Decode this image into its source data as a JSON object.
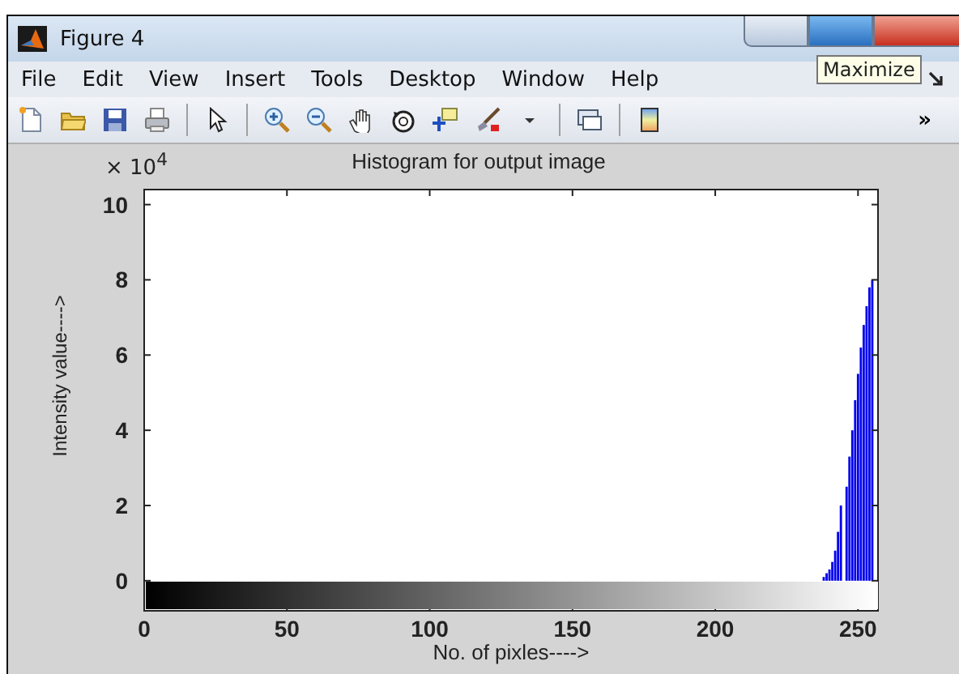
{
  "window": {
    "title": "Figure 4",
    "tooltip": "Maximize"
  },
  "menu": [
    "File",
    "Edit",
    "View",
    "Insert",
    "Tools",
    "Desktop",
    "Window",
    "Help"
  ],
  "toolbar": [
    {
      "kind": "new"
    },
    {
      "kind": "open"
    },
    {
      "kind": "save"
    },
    {
      "kind": "print"
    },
    {
      "kind": "separator"
    },
    {
      "kind": "pointer"
    },
    {
      "kind": "separator"
    },
    {
      "kind": "zoom-in"
    },
    {
      "kind": "zoom-out"
    },
    {
      "kind": "pan"
    },
    {
      "kind": "rotate"
    },
    {
      "kind": "cursor"
    },
    {
      "kind": "brush"
    },
    {
      "kind": "caret"
    },
    {
      "kind": "separator"
    },
    {
      "kind": "link"
    },
    {
      "kind": "separator"
    },
    {
      "kind": "colorbar"
    }
  ],
  "toolbar_overflow": "»",
  "figure": {
    "exponent_label": "× 10$^{4}$",
    "chart_data": {
      "type": "bar",
      "title": "Histogram for output image",
      "xlabel": "No. of pixles---->",
      "ylabel": "Intensity value---->",
      "x": [
        238,
        239,
        240,
        241,
        242,
        243,
        244,
        246,
        247,
        248,
        249,
        250,
        251,
        252,
        253,
        254,
        255
      ],
      "values": [
        0.1,
        0.2,
        0.3,
        0.5,
        0.8,
        1.3,
        2.0,
        2.5,
        3.3,
        4.0,
        4.8,
        5.5,
        6.2,
        6.8,
        7.3,
        7.8,
        8.0
      ],
      "xlim": [
        0,
        257
      ],
      "ylim": [
        -0.8,
        10.4
      ],
      "xticks": [
        0,
        50,
        100,
        150,
        200,
        250
      ],
      "yticks": [
        0,
        2,
        4,
        6,
        8,
        10
      ]
    }
  }
}
